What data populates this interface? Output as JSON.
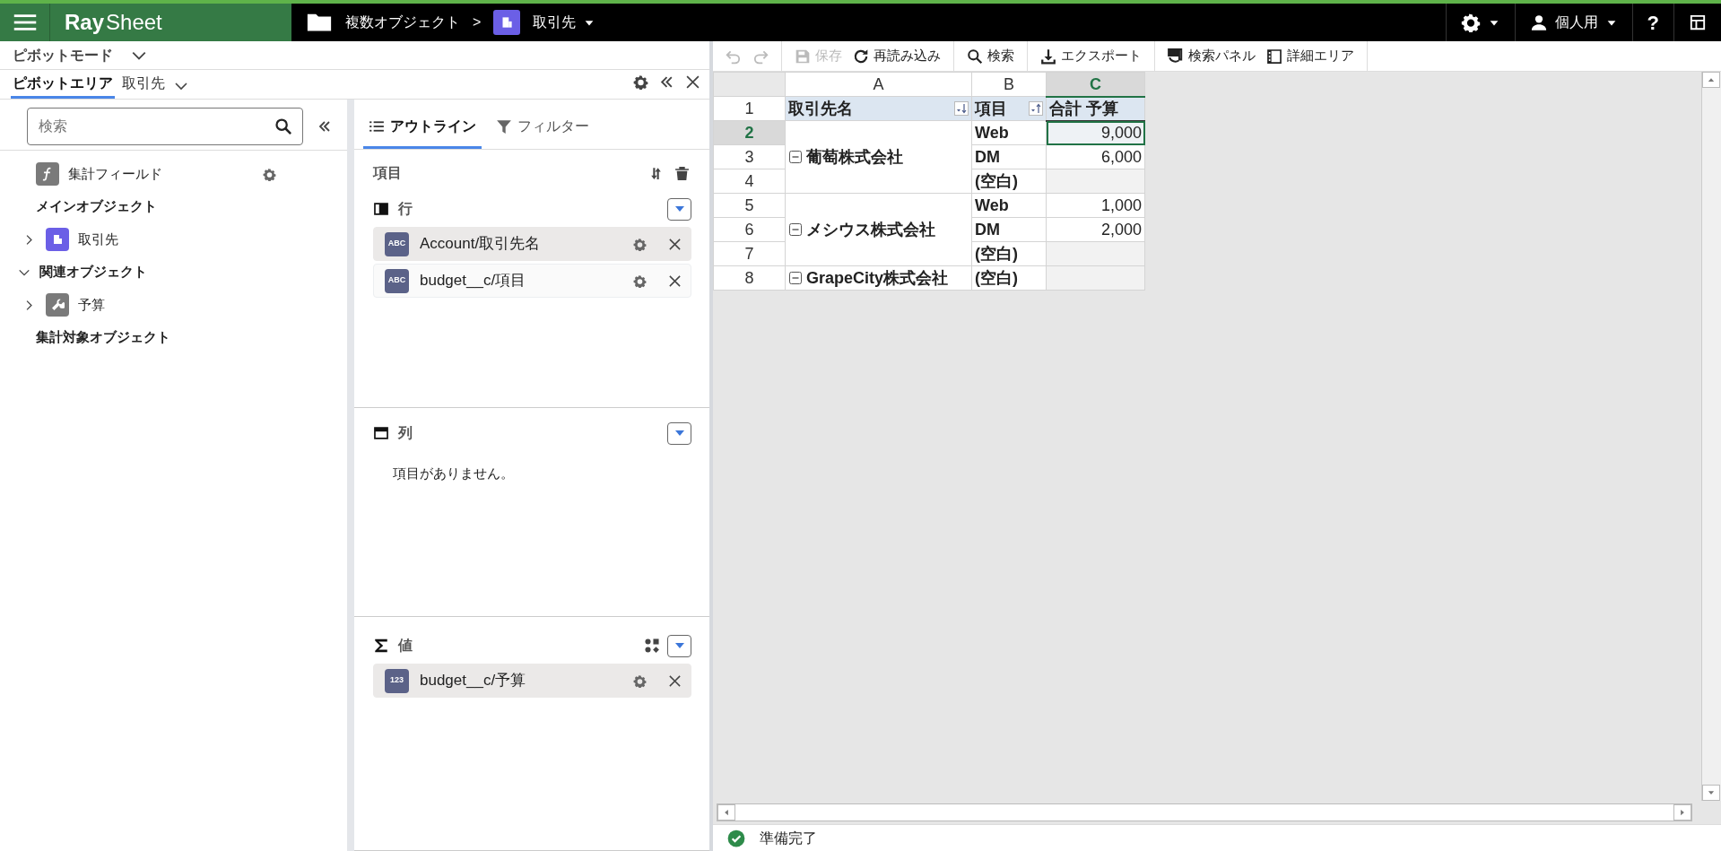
{
  "app_bar": {
    "logo": {
      "part_1": "Ray",
      "part_2": "Sheet"
    },
    "folder": "複数オブジェクト",
    "separator": ">",
    "object": "取引先",
    "user": "個人用",
    "help": "?"
  },
  "mode": {
    "label": "ピボットモード"
  },
  "panel_tabs": [
    {
      "label": "ピボットエリア",
      "selected": true
    },
    {
      "label": "取引先",
      "selected": false
    }
  ],
  "field_list": {
    "search": {
      "placeholder": "検索"
    },
    "calc_field": "集計フィールド",
    "sections": [
      {
        "title": "メインオブジェクト",
        "children": [
          {
            "label": "取引先",
            "expanded": false
          }
        ]
      },
      {
        "title": "関連オブジェクト",
        "expanded": true,
        "children": [
          {
            "label": "予算",
            "expanded": false
          }
        ]
      },
      {
        "title": "集計対象オブジェクト"
      }
    ]
  },
  "layout_tabs": [
    {
      "label": "アウトライン",
      "selected": true
    },
    {
      "label": "フィルター",
      "selected": false
    }
  ],
  "fields_header": "項目",
  "areas": [
    {
      "kind": "rows",
      "title": "行",
      "items": [
        {
          "badge": "ABC",
          "label": "Account/取引先名",
          "selected": true
        },
        {
          "badge": "ABC",
          "label": "budget__c/項目",
          "selected": false
        }
      ]
    },
    {
      "kind": "columns",
      "title": "列",
      "empty_text": "項目がありません。"
    },
    {
      "kind": "values",
      "title": "値",
      "items": [
        {
          "badge": "123",
          "label": "budget__c/予算",
          "selected": true
        }
      ]
    }
  ],
  "toolbar": [
    {
      "items": [
        {
          "disabled": true
        },
        {
          "disabled": true
        }
      ]
    },
    {
      "items": [
        {
          "label": "保存",
          "disabled": true
        },
        {
          "label": "再読み込み",
          "disabled": false
        }
      ]
    },
    {
      "items": [
        {
          "label": "検索",
          "disabled": false
        }
      ]
    },
    {
      "items": [
        {
          "label": "エクスポート",
          "disabled": false
        }
      ]
    },
    {
      "items": [
        {
          "label": "検索パネル",
          "disabled": false
        },
        {
          "label": "詳細エリア",
          "disabled": false
        }
      ]
    }
  ],
  "sheet": {
    "columns": [
      {
        "letter": "A",
        "selected": false
      },
      {
        "letter": "B",
        "selected": false
      },
      {
        "letter": "C",
        "selected": true
      }
    ],
    "row_numbers": [
      {
        "label": "1",
        "selected": false
      },
      {
        "label": "2",
        "selected": true
      },
      {
        "label": "3",
        "selected": false
      },
      {
        "label": "4",
        "selected": false
      },
      {
        "label": "5",
        "selected": false
      },
      {
        "label": "6",
        "selected": false
      },
      {
        "label": "7",
        "selected": false
      },
      {
        "label": "8",
        "selected": false
      }
    ],
    "header": [
      {
        "label": "取引先名"
      },
      {
        "label": "項目"
      },
      {
        "label": "合計 予算"
      }
    ],
    "groups": [
      {
        "name": "葡萄株式会社",
        "items": [
          {
            "item": "Web",
            "value": "9,000",
            "active": true
          },
          {
            "item": "DM",
            "value": "6,000",
            "active": false
          },
          {
            "item": "(空白)",
            "active": false
          }
        ]
      },
      {
        "name": "メシウス株式会社",
        "items": [
          {
            "item": "Web",
            "value": "1,000",
            "active": false
          },
          {
            "item": "DM",
            "value": "2,000",
            "active": false
          },
          {
            "item": "(空白)",
            "active": false
          }
        ]
      },
      {
        "name": "GrapeCity株式会社",
        "items": [
          {
            "item": "(空白)",
            "active": false
          }
        ]
      }
    ]
  },
  "status_bar": {
    "text": "準備完了"
  }
}
